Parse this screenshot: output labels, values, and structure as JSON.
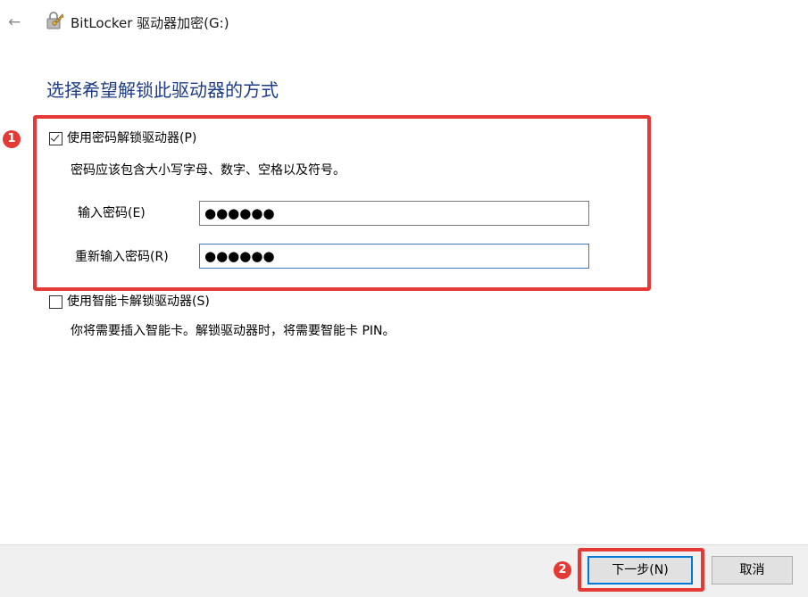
{
  "window": {
    "title": "BitLocker 驱动器加密(G:)",
    "back_icon": "back-arrow-icon",
    "app_icon": "bitlocker-icon"
  },
  "heading": "选择希望解锁此驱动器的方式",
  "annotations": {
    "badge_1": "1",
    "badge_2": "2",
    "highlight_color": "#e53935"
  },
  "password_option": {
    "label": "使用密码解锁驱动器(P)",
    "checked": true,
    "hint": "密码应该包含大小写字母、数字、空格以及符号。",
    "enter_label": "输入密码(E)",
    "enter_value": "●●●●●●",
    "reenter_label": "重新输入密码(R)",
    "reenter_value": "●●●●●●"
  },
  "smartcard_option": {
    "label": "使用智能卡解锁驱动器(S)",
    "checked": false,
    "hint": "你将需要插入智能卡。解锁驱动器时，将需要智能卡 PIN。"
  },
  "footer": {
    "next_label": "下一步(N)",
    "cancel_label": "取消"
  },
  "colors": {
    "heading": "#1f3c88",
    "accent": "#0078d7"
  }
}
